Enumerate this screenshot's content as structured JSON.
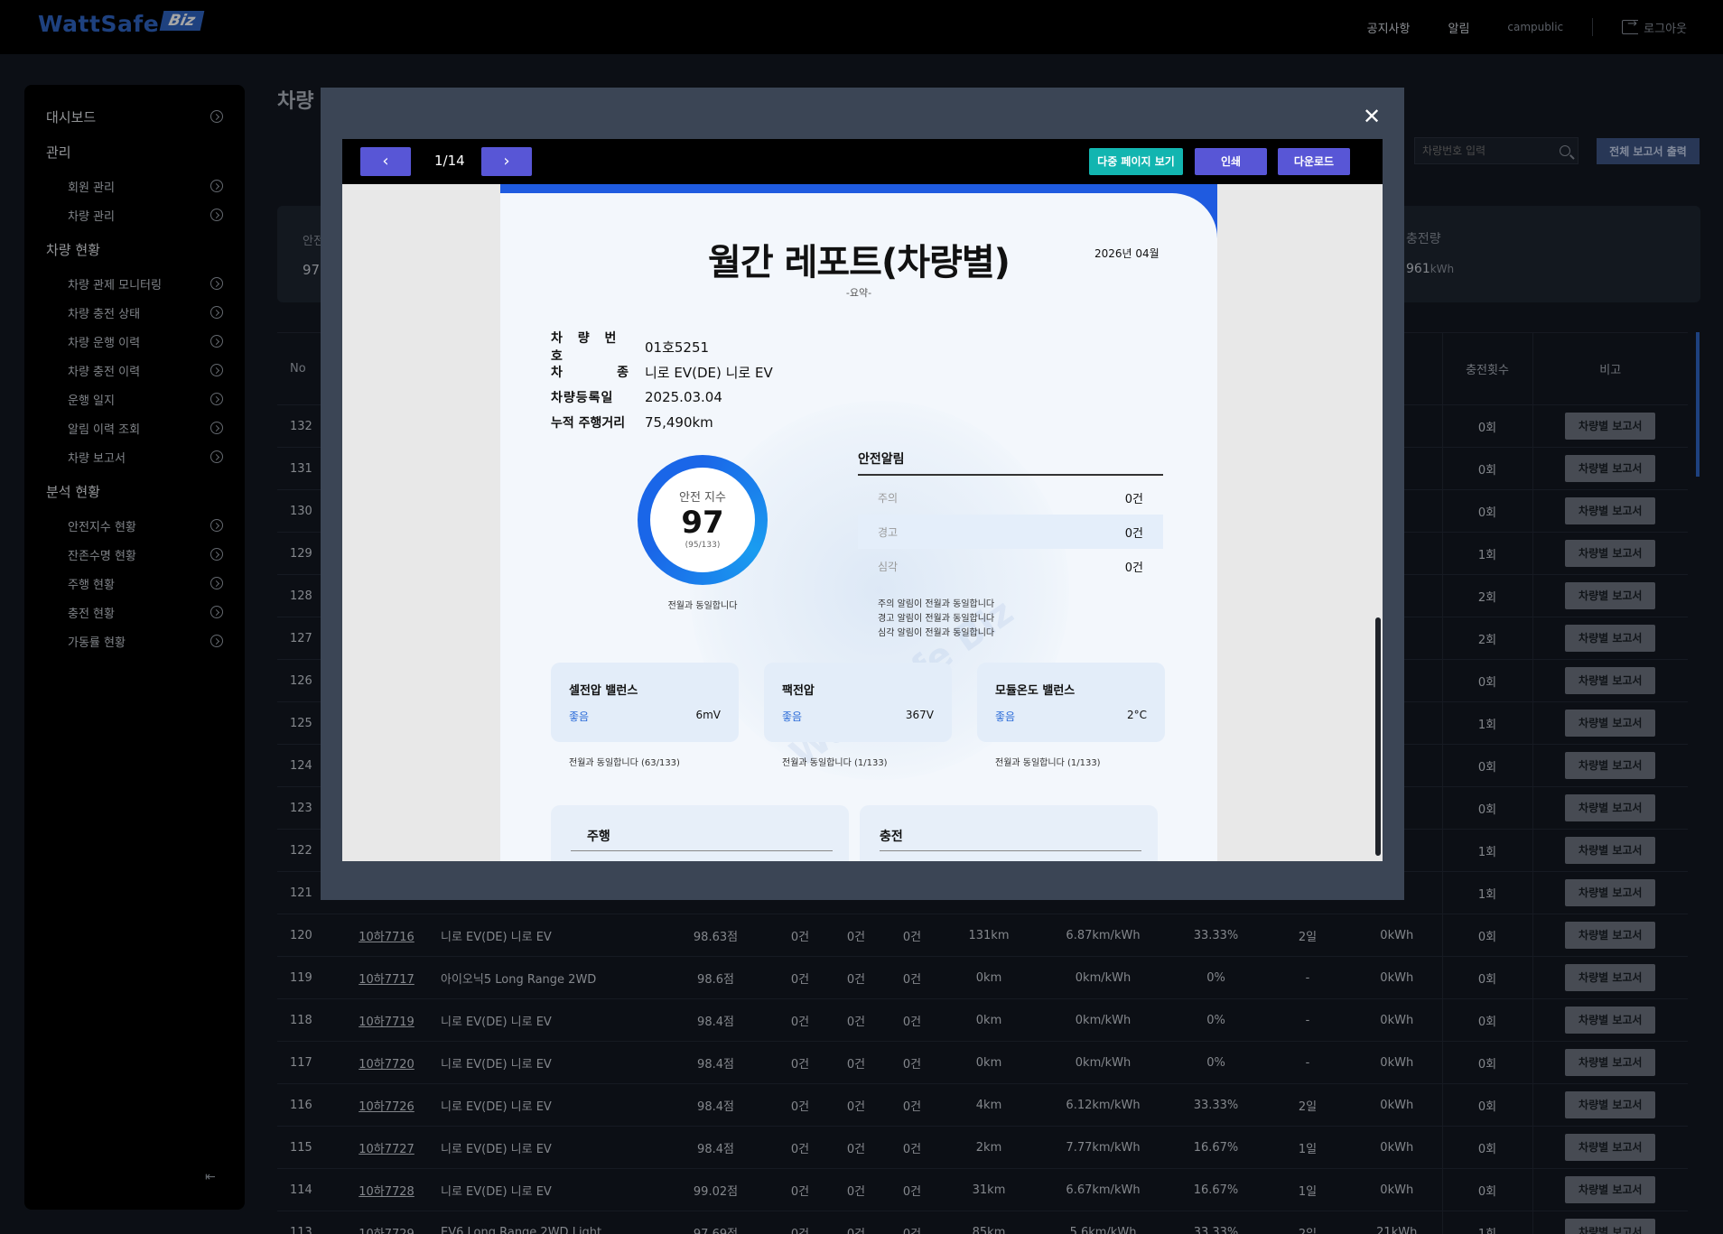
{
  "header": {
    "logo_text": "WattSafe",
    "logo_badge": "Biz",
    "nav": [
      "공지사항",
      "알림"
    ],
    "user": "campublic",
    "logout": "로그아웃"
  },
  "sidebar": {
    "dashboard": "대시보드",
    "sections": [
      {
        "title": "관리",
        "items": [
          "회원 관리",
          "차량 관리"
        ]
      },
      {
        "title": "차량 현황",
        "items": [
          "차량 관제 모니터링",
          "차량 충전 상태",
          "차량 운행 이력",
          "차량 충전 이력",
          "운행 일지",
          "알림 이력 조회",
          "차량 보고서"
        ]
      },
      {
        "title": "분석 현황",
        "items": [
          "안전지수 현황",
          "잔존수명 현황",
          "주행 현황",
          "충전 현황",
          "가동률 현황"
        ]
      }
    ]
  },
  "main": {
    "title": "차량",
    "search_placeholder": "차량번호 입력",
    "print_all": "전체 보고서 출력",
    "summary_left_label": "안전",
    "summary_left_value": "97",
    "summary_right_label": "충전량",
    "summary_right_value": "961",
    "summary_right_unit": "kWh",
    "table_headers": {
      "no": "No",
      "charge_amount": "량",
      "charge_count": "충전횟수",
      "note": "비고"
    },
    "report_btn": "차량별 보고서",
    "rows_hidden": [
      {
        "no": "132",
        "amt": "h",
        "cnt": "0회"
      },
      {
        "no": "131",
        "amt": "h",
        "cnt": "0회"
      },
      {
        "no": "130",
        "amt": "h",
        "cnt": "0회"
      },
      {
        "no": "129",
        "amt": "/h",
        "cnt": "1회"
      },
      {
        "no": "128",
        "amt": "/h",
        "cnt": "2회"
      },
      {
        "no": "127",
        "amt": "h",
        "cnt": "2회"
      },
      {
        "no": "126",
        "amt": "h",
        "cnt": "0회"
      },
      {
        "no": "125",
        "amt": "/h",
        "cnt": "1회"
      },
      {
        "no": "124",
        "amt": "h",
        "cnt": "0회"
      },
      {
        "no": "123",
        "amt": "h",
        "cnt": "0회"
      },
      {
        "no": "122",
        "amt": "/h",
        "cnt": "1회"
      },
      {
        "no": "121",
        "amt": "/h",
        "cnt": "1회"
      }
    ],
    "rows": [
      {
        "no": "120",
        "plate": "10하7716",
        "model": "니로 EV(DE) 니로 EV",
        "score": "98.63점",
        "a1": "0건",
        "a2": "0건",
        "a3": "0건",
        "dist": "131km",
        "eff": "6.87km/kWh",
        "rate": "33.33%",
        "days": "2일",
        "amt": "0kWh",
        "cnt": "0회"
      },
      {
        "no": "119",
        "plate": "10하7717",
        "model": "아이오닉5 Long Range 2WD",
        "score": "98.6점",
        "a1": "0건",
        "a2": "0건",
        "a3": "0건",
        "dist": "0km",
        "eff": "0km/kWh",
        "rate": "0%",
        "days": "-",
        "amt": "0kWh",
        "cnt": "0회"
      },
      {
        "no": "118",
        "plate": "10하7719",
        "model": "니로 EV(DE) 니로 EV",
        "score": "98.4점",
        "a1": "0건",
        "a2": "0건",
        "a3": "0건",
        "dist": "0km",
        "eff": "0km/kWh",
        "rate": "0%",
        "days": "-",
        "amt": "0kWh",
        "cnt": "0회"
      },
      {
        "no": "117",
        "plate": "10하7720",
        "model": "니로 EV(DE) 니로 EV",
        "score": "98.4점",
        "a1": "0건",
        "a2": "0건",
        "a3": "0건",
        "dist": "0km",
        "eff": "0km/kWh",
        "rate": "0%",
        "days": "-",
        "amt": "0kWh",
        "cnt": "0회"
      },
      {
        "no": "116",
        "plate": "10하7726",
        "model": "니로 EV(DE) 니로 EV",
        "score": "98.4점",
        "a1": "0건",
        "a2": "0건",
        "a3": "0건",
        "dist": "4km",
        "eff": "6.12km/kWh",
        "rate": "33.33%",
        "days": "2일",
        "amt": "0kWh",
        "cnt": "0회"
      },
      {
        "no": "115",
        "plate": "10하7727",
        "model": "니로 EV(DE) 니로 EV",
        "score": "98.4점",
        "a1": "0건",
        "a2": "0건",
        "a3": "0건",
        "dist": "2km",
        "eff": "7.77km/kWh",
        "rate": "16.67%",
        "days": "1일",
        "amt": "0kWh",
        "cnt": "0회"
      },
      {
        "no": "114",
        "plate": "10하7728",
        "model": "니로 EV(DE) 니로 EV",
        "score": "99.02점",
        "a1": "0건",
        "a2": "0건",
        "a3": "0건",
        "dist": "31km",
        "eff": "6.67km/kWh",
        "rate": "16.67%",
        "days": "1일",
        "amt": "0kWh",
        "cnt": "0회"
      },
      {
        "no": "113",
        "plate": "10하7729",
        "model": "EV6 Long Range 2WD Light",
        "score": "97.69점",
        "a1": "0건",
        "a2": "0건",
        "a3": "0건",
        "dist": "85km",
        "eff": "5.6km/kWh",
        "rate": "33.33%",
        "days": "2일",
        "amt": "21kWh",
        "cnt": "1회"
      }
    ]
  },
  "viewer": {
    "page_indicator": "1/14",
    "multi_page": "다중 페이지 보기",
    "print": "인쇄",
    "download": "다운로드",
    "colors": {
      "multi_page": "#12b5b0",
      "print": "#5856d6",
      "download": "#5856d6"
    }
  },
  "report": {
    "title": "월간 레포트(차량별)",
    "date": "2026년 04월",
    "subtitle": "-요약-",
    "info": [
      {
        "label": "차 량 번 호",
        "value": "01호5251"
      },
      {
        "label": "차          종",
        "value": "니로 EV(DE) 니로 EV"
      },
      {
        "label": "차량등록일",
        "value": "2025.03.04"
      },
      {
        "label": "누적 주행거리",
        "value": "75,490km"
      }
    ],
    "safety": {
      "label": "안전 지수",
      "value": "97",
      "sub": "(95/133)",
      "note": "전월과 동일합니다"
    },
    "alerts": {
      "title": "안전알림",
      "rows": [
        {
          "k": "주의",
          "v": "0건"
        },
        {
          "k": "경고",
          "v": "0건"
        },
        {
          "k": "심각",
          "v": "0건"
        }
      ],
      "notes": [
        "주의 알림이 전월과 동일합니다",
        "경고 알림이 전월과 동일합니다",
        "심각 알림이 전월과 동일합니다"
      ]
    },
    "metrics": [
      {
        "title": "셀전압 밸런스",
        "status": "좋음",
        "value": "6mV",
        "note": "전월과 동일합니다 (63/133)"
      },
      {
        "title": "팩전압",
        "status": "좋음",
        "value": "367V",
        "note": "전월과 동일합니다 (1/133)"
      },
      {
        "title": "모듈온도 밸런스",
        "status": "좋음",
        "value": "2°C",
        "note": "전월과 동일합니다 (1/133)"
      }
    ],
    "sections": [
      "주행",
      "충전"
    ],
    "watermark": "WattSafe Biz"
  }
}
